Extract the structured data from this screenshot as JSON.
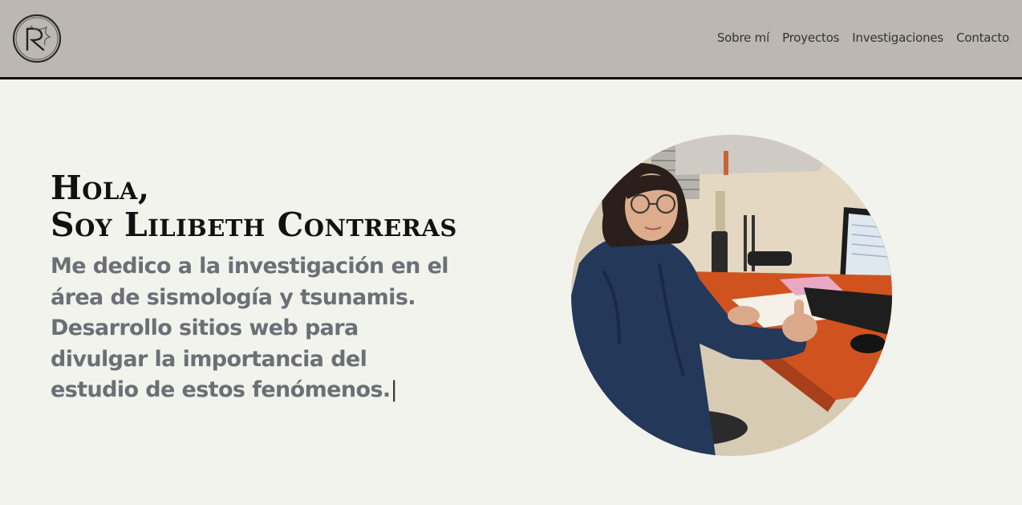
{
  "nav": {
    "links": [
      "Sobre mí",
      "Proyectos",
      "Investigaciones",
      "Contacto"
    ]
  },
  "hero": {
    "greeting_line1": "Hola,",
    "greeting_line2": "Soy Lilibeth Contreras",
    "intro_line1": "Me dedico a la investigación en el",
    "intro_line2": "área de sismología y tsunamis.",
    "intro_line3": "Desarrollo sitios web para",
    "intro_line4": "divulgar la importancia del",
    "intro_line5": "estudio de estos fenómenos.",
    "cursor": "|"
  },
  "colors": {
    "navbar_bg": "#bcb8b1",
    "page_bg": "#f3f3ee",
    "heading": "#111111",
    "intro_text": "#6b7076"
  }
}
